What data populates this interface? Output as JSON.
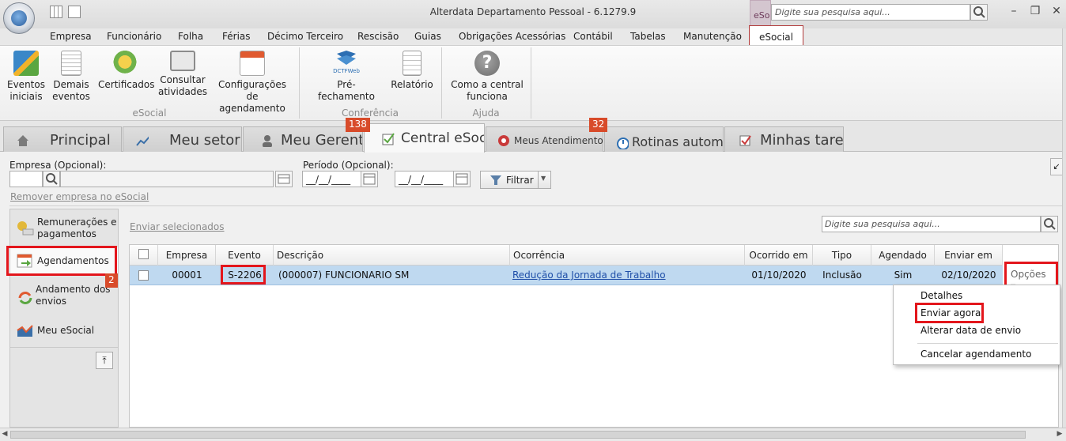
{
  "window": {
    "title": "Alterdata Departamento Pessoal - 6.1279.9",
    "search_tab_label": "eSocial",
    "search_placeholder": "Digite sua pesquisa aqui..."
  },
  "menu": {
    "items": [
      {
        "label": "Empresa"
      },
      {
        "label": "Funcionário"
      },
      {
        "label": "Folha"
      },
      {
        "label": "Férias"
      },
      {
        "label": "Décimo Terceiro"
      },
      {
        "label": "Rescisão"
      },
      {
        "label": "Guias"
      },
      {
        "label": "Obrigações Acessórias"
      },
      {
        "label": "Contábil"
      },
      {
        "label": "Tabelas"
      },
      {
        "label": "Manutenção"
      },
      {
        "label": "eSocial"
      }
    ]
  },
  "ribbon": {
    "groups": [
      {
        "label": "eSocial"
      },
      {
        "label": "Conferência"
      },
      {
        "label": "Ajuda"
      }
    ],
    "buttons": [
      {
        "line1": "Eventos",
        "line2": "iniciais"
      },
      {
        "line1": "Demais",
        "line2": "eventos"
      },
      {
        "line1": "Certificados",
        "line2": ""
      },
      {
        "line1": "Consultar",
        "line2": "atividades"
      },
      {
        "line1": "Configurações",
        "line2": "de agendamento"
      },
      {
        "line1": "Pré-fechamento",
        "line2": "",
        "icon_text": "DCTFWeb"
      },
      {
        "line1": "Relatório",
        "line2": ""
      },
      {
        "line1": "Como a central",
        "line2": "funciona"
      }
    ]
  },
  "module_tabs": [
    {
      "label": "Principal"
    },
    {
      "label": "Meu setor"
    },
    {
      "label": "Meu Gerente"
    },
    {
      "label": "Central eSocial"
    },
    {
      "label": "Meus Atendimentos"
    },
    {
      "label": "Rotinas automáticas"
    },
    {
      "label": "Minhas tarefas"
    }
  ],
  "badges": {
    "meu_gerente": "138",
    "meus_atendimentos": "32",
    "agendamentos": "2"
  },
  "filters": {
    "empresa_label": "Empresa (Opcional):",
    "periodo_label": "Período (Opcional):",
    "date_mask": "__/__/____",
    "filter_button": "Filtrar",
    "remove_link": "Remover empresa no eSocial"
  },
  "left_panel": [
    {
      "line1": "Remunerações e",
      "line2": "pagamentos"
    },
    {
      "line1": "Agendamentos",
      "line2": ""
    },
    {
      "line1": "Andamento dos",
      "line2": "envios"
    },
    {
      "line1": "Meu eSocial",
      "line2": ""
    }
  ],
  "grid": {
    "send_selected": "Enviar selecionados",
    "search_placeholder": "Digite sua pesquisa aqui...",
    "columns": [
      "Empresa",
      "Evento",
      "Descrição",
      "Ocorrência",
      "Ocorrido em",
      "Tipo",
      "Agendado",
      "Enviar em"
    ],
    "row": {
      "empresa": "00001",
      "evento": "S-2206",
      "descricao": "(000007) FUNCIONARIO SM",
      "ocorrencia": "Redução da Jornada de Trabalho",
      "ocorrido_em": "01/10/2020",
      "tipo": "Inclusão",
      "agendado": "Sim",
      "enviar_em": "02/10/2020"
    },
    "options_button": "Opções"
  },
  "context_menu": {
    "items": [
      {
        "label": "Detalhes"
      },
      {
        "label": "Enviar agora"
      },
      {
        "label": "Alterar data de envio"
      },
      {
        "label": "Cancelar agendamento"
      }
    ]
  },
  "colors": {
    "highlight_red": "#e3161c",
    "selected_row": "#bfd9f0",
    "badge": "#d84b2a"
  }
}
